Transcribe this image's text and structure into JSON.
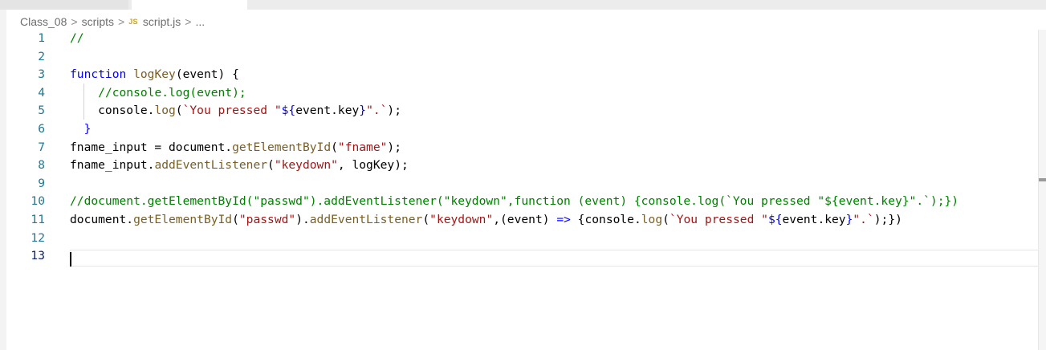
{
  "breadcrumb": {
    "folder1": "Class_08",
    "folder2": "scripts",
    "file_icon": "JS",
    "file": "script.js",
    "more": "...",
    "separator": ">"
  },
  "lines": [
    {
      "num": "1",
      "tokens": [
        {
          "c": "t-comment",
          "t": "//"
        }
      ]
    },
    {
      "num": "2",
      "tokens": []
    },
    {
      "num": "3",
      "tokens": [
        {
          "c": "t-keyword",
          "t": "function"
        },
        {
          "c": "t-plain",
          "t": " "
        },
        {
          "c": "t-func",
          "t": "logKey"
        },
        {
          "c": "t-plain",
          "t": "(event) {"
        }
      ]
    },
    {
      "num": "4",
      "tokens": [
        {
          "c": "t-plain",
          "t": "    "
        },
        {
          "c": "t-comment",
          "t": "//console.log(event);"
        }
      ]
    },
    {
      "num": "5",
      "tokens": [
        {
          "c": "t-plain",
          "t": "    console."
        },
        {
          "c": "t-func",
          "t": "log"
        },
        {
          "c": "t-plain",
          "t": "("
        },
        {
          "c": "t-string",
          "t": "`You pressed \""
        },
        {
          "c": "t-keyword",
          "t": "${"
        },
        {
          "c": "t-plain",
          "t": "event.key"
        },
        {
          "c": "t-keyword",
          "t": "}"
        },
        {
          "c": "t-string",
          "t": "\".`"
        },
        {
          "c": "t-plain",
          "t": ");"
        }
      ]
    },
    {
      "num": "6",
      "tokens": [
        {
          "c": "t-plain",
          "t": "  "
        },
        {
          "c": "t-keyword",
          "t": "}"
        }
      ]
    },
    {
      "num": "7",
      "tokens": [
        {
          "c": "t-plain",
          "t": "fname_input = document."
        },
        {
          "c": "t-func",
          "t": "getElementById"
        },
        {
          "c": "t-plain",
          "t": "("
        },
        {
          "c": "t-string",
          "t": "\"fname\""
        },
        {
          "c": "t-plain",
          "t": ");"
        }
      ]
    },
    {
      "num": "8",
      "tokens": [
        {
          "c": "t-plain",
          "t": "fname_input."
        },
        {
          "c": "t-func",
          "t": "addEventListener"
        },
        {
          "c": "t-plain",
          "t": "("
        },
        {
          "c": "t-string",
          "t": "\"keydown\""
        },
        {
          "c": "t-plain",
          "t": ", logKey);"
        }
      ]
    },
    {
      "num": "9",
      "tokens": []
    },
    {
      "num": "10",
      "tokens": [
        {
          "c": "t-comment",
          "t": "//document.getElementById(\"passwd\").addEventListener(\"keydown\",function (event) {console.log(`You pressed \"${event.key}\".`);})"
        }
      ]
    },
    {
      "num": "11",
      "tokens": [
        {
          "c": "t-plain",
          "t": "document."
        },
        {
          "c": "t-func",
          "t": "getElementById"
        },
        {
          "c": "t-plain",
          "t": "("
        },
        {
          "c": "t-string",
          "t": "\"passwd\""
        },
        {
          "c": "t-plain",
          "t": ")."
        },
        {
          "c": "t-func",
          "t": "addEventListener"
        },
        {
          "c": "t-plain",
          "t": "("
        },
        {
          "c": "t-string",
          "t": "\"keydown\""
        },
        {
          "c": "t-plain",
          "t": ",(event) "
        },
        {
          "c": "t-keyword",
          "t": "=>"
        },
        {
          "c": "t-plain",
          "t": " {console."
        },
        {
          "c": "t-func",
          "t": "log"
        },
        {
          "c": "t-plain",
          "t": "("
        },
        {
          "c": "t-string",
          "t": "`You pressed \""
        },
        {
          "c": "t-keyword",
          "t": "${"
        },
        {
          "c": "t-plain",
          "t": "event.key"
        },
        {
          "c": "t-keyword",
          "t": "}"
        },
        {
          "c": "t-string",
          "t": "\".`"
        },
        {
          "c": "t-plain",
          "t": ");})"
        }
      ]
    },
    {
      "num": "12",
      "tokens": []
    },
    {
      "num": "13",
      "tokens": [],
      "active": true
    }
  ]
}
